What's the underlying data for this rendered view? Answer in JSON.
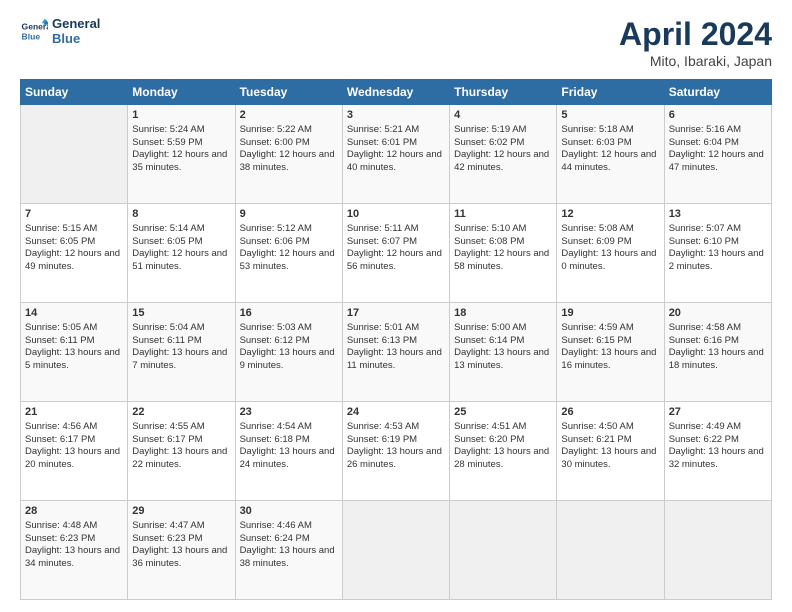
{
  "header": {
    "logo_line1": "General",
    "logo_line2": "Blue",
    "month_title": "April 2024",
    "location": "Mito, Ibaraki, Japan"
  },
  "weekdays": [
    "Sunday",
    "Monday",
    "Tuesday",
    "Wednesday",
    "Thursday",
    "Friday",
    "Saturday"
  ],
  "weeks": [
    [
      {
        "day": "",
        "empty": true
      },
      {
        "day": "1",
        "sunrise": "5:24 AM",
        "sunset": "5:59 PM",
        "daylight": "12 hours and 35 minutes."
      },
      {
        "day": "2",
        "sunrise": "5:22 AM",
        "sunset": "6:00 PM",
        "daylight": "12 hours and 38 minutes."
      },
      {
        "day": "3",
        "sunrise": "5:21 AM",
        "sunset": "6:01 PM",
        "daylight": "12 hours and 40 minutes."
      },
      {
        "day": "4",
        "sunrise": "5:19 AM",
        "sunset": "6:02 PM",
        "daylight": "12 hours and 42 minutes."
      },
      {
        "day": "5",
        "sunrise": "5:18 AM",
        "sunset": "6:03 PM",
        "daylight": "12 hours and 44 minutes."
      },
      {
        "day": "6",
        "sunrise": "5:16 AM",
        "sunset": "6:04 PM",
        "daylight": "12 hours and 47 minutes."
      }
    ],
    [
      {
        "day": "7",
        "sunrise": "5:15 AM",
        "sunset": "6:05 PM",
        "daylight": "12 hours and 49 minutes."
      },
      {
        "day": "8",
        "sunrise": "5:14 AM",
        "sunset": "6:05 PM",
        "daylight": "12 hours and 51 minutes."
      },
      {
        "day": "9",
        "sunrise": "5:12 AM",
        "sunset": "6:06 PM",
        "daylight": "12 hours and 53 minutes."
      },
      {
        "day": "10",
        "sunrise": "5:11 AM",
        "sunset": "6:07 PM",
        "daylight": "12 hours and 56 minutes."
      },
      {
        "day": "11",
        "sunrise": "5:10 AM",
        "sunset": "6:08 PM",
        "daylight": "12 hours and 58 minutes."
      },
      {
        "day": "12",
        "sunrise": "5:08 AM",
        "sunset": "6:09 PM",
        "daylight": "13 hours and 0 minutes."
      },
      {
        "day": "13",
        "sunrise": "5:07 AM",
        "sunset": "6:10 PM",
        "daylight": "13 hours and 2 minutes."
      }
    ],
    [
      {
        "day": "14",
        "sunrise": "5:05 AM",
        "sunset": "6:11 PM",
        "daylight": "13 hours and 5 minutes."
      },
      {
        "day": "15",
        "sunrise": "5:04 AM",
        "sunset": "6:11 PM",
        "daylight": "13 hours and 7 minutes."
      },
      {
        "day": "16",
        "sunrise": "5:03 AM",
        "sunset": "6:12 PM",
        "daylight": "13 hours and 9 minutes."
      },
      {
        "day": "17",
        "sunrise": "5:01 AM",
        "sunset": "6:13 PM",
        "daylight": "13 hours and 11 minutes."
      },
      {
        "day": "18",
        "sunrise": "5:00 AM",
        "sunset": "6:14 PM",
        "daylight": "13 hours and 13 minutes."
      },
      {
        "day": "19",
        "sunrise": "4:59 AM",
        "sunset": "6:15 PM",
        "daylight": "13 hours and 16 minutes."
      },
      {
        "day": "20",
        "sunrise": "4:58 AM",
        "sunset": "6:16 PM",
        "daylight": "13 hours and 18 minutes."
      }
    ],
    [
      {
        "day": "21",
        "sunrise": "4:56 AM",
        "sunset": "6:17 PM",
        "daylight": "13 hours and 20 minutes."
      },
      {
        "day": "22",
        "sunrise": "4:55 AM",
        "sunset": "6:17 PM",
        "daylight": "13 hours and 22 minutes."
      },
      {
        "day": "23",
        "sunrise": "4:54 AM",
        "sunset": "6:18 PM",
        "daylight": "13 hours and 24 minutes."
      },
      {
        "day": "24",
        "sunrise": "4:53 AM",
        "sunset": "6:19 PM",
        "daylight": "13 hours and 26 minutes."
      },
      {
        "day": "25",
        "sunrise": "4:51 AM",
        "sunset": "6:20 PM",
        "daylight": "13 hours and 28 minutes."
      },
      {
        "day": "26",
        "sunrise": "4:50 AM",
        "sunset": "6:21 PM",
        "daylight": "13 hours and 30 minutes."
      },
      {
        "day": "27",
        "sunrise": "4:49 AM",
        "sunset": "6:22 PM",
        "daylight": "13 hours and 32 minutes."
      }
    ],
    [
      {
        "day": "28",
        "sunrise": "4:48 AM",
        "sunset": "6:23 PM",
        "daylight": "13 hours and 34 minutes."
      },
      {
        "day": "29",
        "sunrise": "4:47 AM",
        "sunset": "6:23 PM",
        "daylight": "13 hours and 36 minutes."
      },
      {
        "day": "30",
        "sunrise": "4:46 AM",
        "sunset": "6:24 PM",
        "daylight": "13 hours and 38 minutes."
      },
      {
        "day": "",
        "empty": true
      },
      {
        "day": "",
        "empty": true
      },
      {
        "day": "",
        "empty": true
      },
      {
        "day": "",
        "empty": true
      }
    ]
  ]
}
